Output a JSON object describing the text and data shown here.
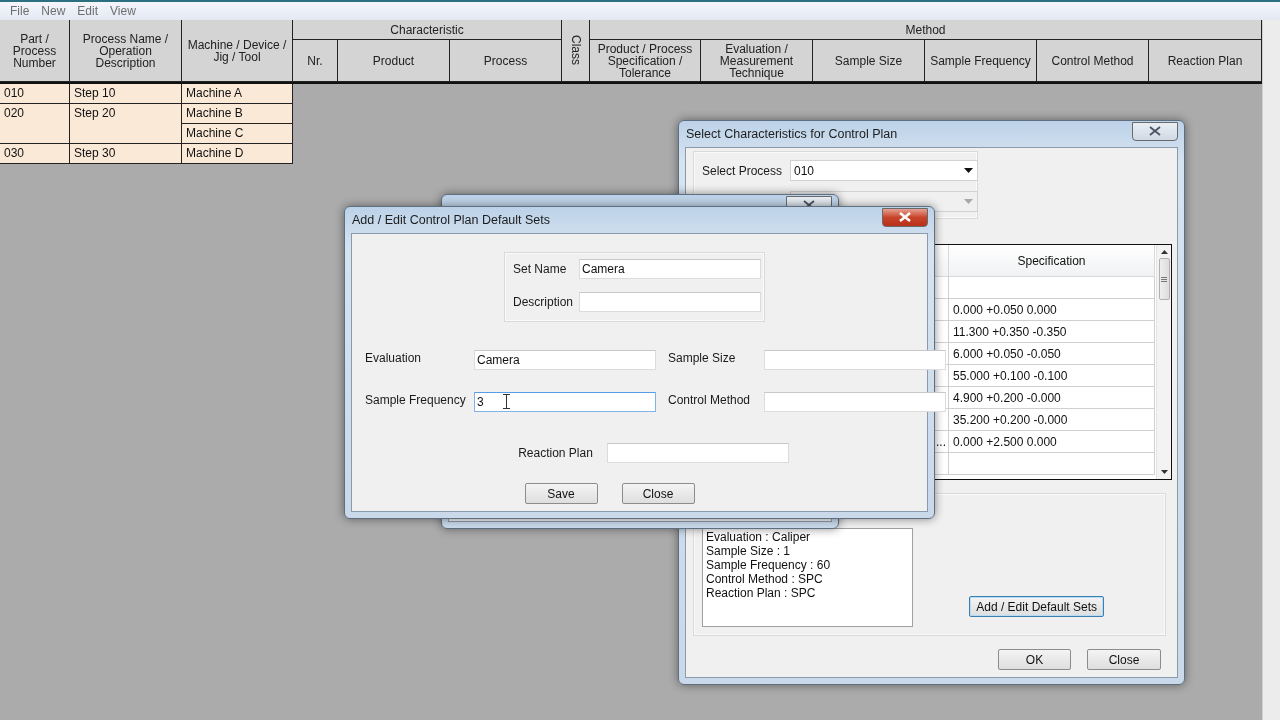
{
  "menu": [
    "File",
    "New",
    "Edit",
    "View"
  ],
  "grid": {
    "columns": [
      {
        "label": "Part / Process Number"
      },
      {
        "label": "Process Name / Operation Description"
      },
      {
        "label": "Machine / Device / Jig / Tool"
      },
      {
        "group": "Characteristic",
        "columns": [
          "Nr.",
          "Product",
          "Process"
        ]
      },
      {
        "label": "Class",
        "kind": "vertical"
      },
      {
        "group": "Method",
        "columns": [
          "Product / Process Specification / Tolerance",
          "Evaluation / Measurement Technique",
          "Sample Size",
          "Sample Frequency",
          "Control Method",
          "Reaction Plan"
        ]
      }
    ],
    "rows": [
      {
        "part": "010",
        "process": "Step 10",
        "machines": [
          "Machine A"
        ]
      },
      {
        "part": "020",
        "process": "Step 20",
        "machines": [
          "Machine B",
          "Machine C"
        ]
      },
      {
        "part": "030",
        "process": "Step 30",
        "machines": [
          "Machine D"
        ]
      }
    ]
  },
  "select_dialog": {
    "title": "Select Characteristics for Control Plan",
    "process_label": "Select Process",
    "process_value": "010",
    "second_select": {
      "disabled": true
    },
    "table_header": "Specification",
    "rows": [
      {
        "specification": ""
      },
      {
        "specification": "0.000 +0.050 0.000"
      },
      {
        "specification": "11.300 +0.350 -0.350"
      },
      {
        "specification": "6.000 +0.050 -0.050"
      },
      {
        "specification": "55.000 +0.100 -0.100"
      },
      {
        "specification": "4.900 +0.200 -0.000"
      },
      {
        "specification": "35.200 +0.200 -0.000"
      },
      {
        "column_1": "...",
        "specification": "0.000 +2.500 0.000"
      },
      {
        "specification": ""
      }
    ],
    "summary": [
      "Evaluation : Caliper",
      "Sample Size : 1",
      "Sample Frequency : 60",
      "Control Method : SPC",
      "Reaction Plan : SPC"
    ],
    "add_button": "Add / Edit Default Sets",
    "ok_button": "OK",
    "close_button": "Close"
  },
  "edit_dialog": {
    "title": "Add / Edit Control Plan Default Sets",
    "set_name": {
      "label": "Set Name",
      "value": "Camera"
    },
    "description": {
      "label": "Description"
    },
    "fields": [
      {
        "label": "Evaluation",
        "value": "Camera",
        "focused": false
      },
      {
        "label": "Sample Size",
        "focused": false
      },
      {
        "label": "Sample Frequency",
        "value": "3",
        "focused": true
      },
      {
        "label": "Control Method",
        "focused": false
      }
    ],
    "reaction_plan": {
      "label": "Reaction Plan"
    },
    "save_button": "Save",
    "close_button": "Close"
  }
}
